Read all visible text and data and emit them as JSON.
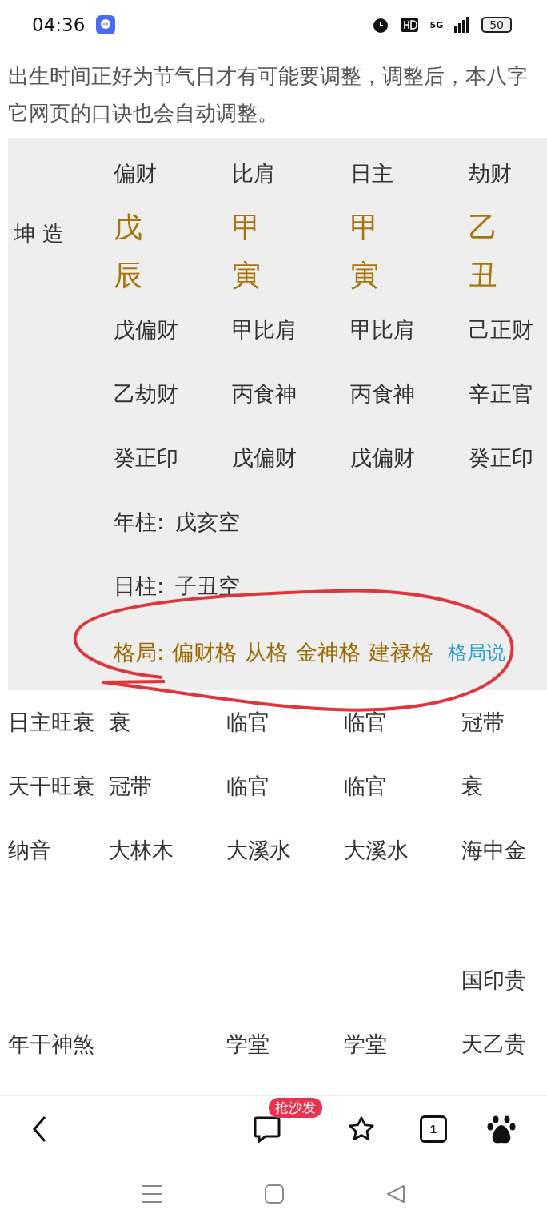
{
  "status_bar": {
    "time": "04:36",
    "network": "5G",
    "battery": "50"
  },
  "notice": [
    "出生时间正好为节气日才有可能要调整，调整后，本八字",
    "它网页的口诀也会自动调整。"
  ],
  "chart": {
    "gender": "坤 造",
    "ten_gods": [
      "偏财",
      "比肩",
      "日主",
      "劫财"
    ],
    "stems": [
      "戊",
      "甲",
      "甲",
      "乙"
    ],
    "branches": [
      "辰",
      "寅",
      "寅",
      "丑"
    ],
    "hidden_stems": [
      [
        "戊偏财",
        "甲比肩",
        "甲比肩",
        "己正财"
      ],
      [
        "乙劫财",
        "丙食神",
        "丙食神",
        "辛正官"
      ],
      [
        "癸正印",
        "戊偏财",
        "戊偏财",
        "癸正印"
      ]
    ],
    "void": [
      {
        "label": "年柱:",
        "value": "戊亥空"
      },
      {
        "label": "日柱:",
        "value": "子丑空"
      }
    ],
    "pattern": {
      "label": "格局:",
      "values": [
        "偏财格",
        "从格",
        "金神格",
        "建禄格"
      ],
      "link": "格局说"
    }
  },
  "rows": [
    {
      "label": "日主旺衰",
      "cells": [
        [
          "衰"
        ],
        [
          "临官"
        ],
        [
          "临官"
        ],
        [
          "冠带"
        ]
      ]
    },
    {
      "label": "天干旺衰",
      "cells": [
        [
          "冠带"
        ],
        [
          "临官"
        ],
        [
          "临官"
        ],
        [
          "衰"
        ]
      ]
    },
    {
      "label": "纳音",
      "cells": [
        [
          "大林木"
        ],
        [
          "大溪水"
        ],
        [
          "大溪水"
        ],
        [
          "海中金"
        ]
      ]
    },
    {
      "label": "年干神煞",
      "cells": [
        [],
        [
          "学堂"
        ],
        [
          "学堂"
        ],
        [
          "国印贵",
          "天乙贵"
        ]
      ]
    }
  ],
  "bottom_bar": {
    "badge": "抢沙发",
    "tab_count": "1"
  }
}
